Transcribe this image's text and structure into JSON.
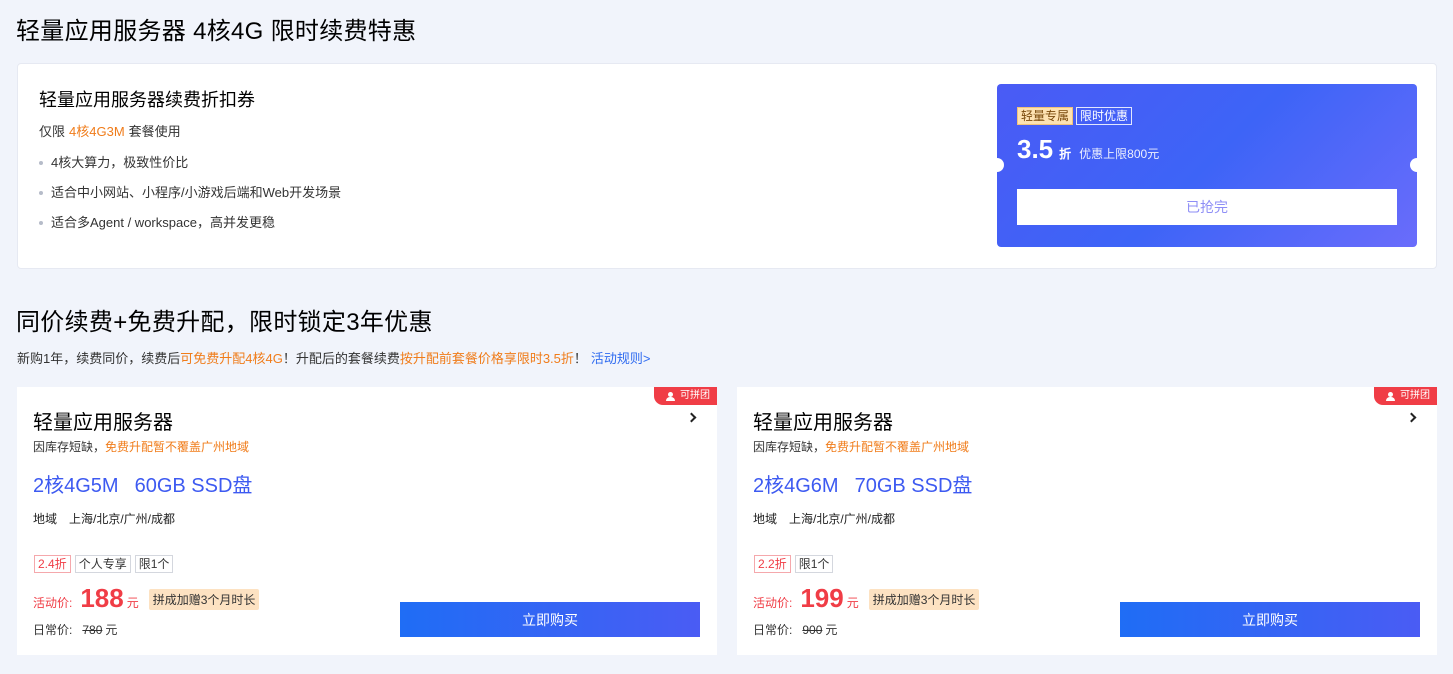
{
  "page_title": "轻量应用服务器 4核4G 限时续费特惠",
  "coupon": {
    "title": "轻量应用服务器续费折扣券",
    "sub_prefix": "仅限",
    "sub_highlight": "4核4G3M",
    "sub_suffix": "套餐使用",
    "features": [
      "4核大算力，极致性价比",
      "适合中小网站、小程序/小游戏后端和Web开发场景",
      "适合多Agent / workspace，高并发更稳"
    ],
    "ticket": {
      "tag_exclusive": "轻量专属",
      "tag_limited": "限时优惠",
      "discount": "3.5",
      "discount_unit": "折",
      "cap": "优惠上限800元",
      "button": "已抢完"
    }
  },
  "section2": {
    "title": "同价续费+免费升配，限时锁定3年优惠",
    "desc_1": "新购1年，续费同价，续费后",
    "desc_2": "可免费升配4核4G",
    "desc_3": "！升配后的套餐续费",
    "desc_4": "按升配前套餐价格享限时3.5折",
    "desc_5": "！",
    "rules_link": "活动规则>"
  },
  "products": [
    {
      "ribbon": "可拼团",
      "name": "轻量应用服务器",
      "stock_prefix": "因库存短缺，",
      "stock_note": "免费升配暂不覆盖广州地域",
      "spec_cpu": "2核4G5M",
      "spec_disk": "60GB SSD盘",
      "region_label": "地域",
      "regions": "上海/北京/广州/成都",
      "tags": [
        "2.4折",
        "个人专享",
        "限1个"
      ],
      "price_label": "活动价:",
      "price": "188",
      "price_unit": "元",
      "bonus": "拼成加赠3个月时长",
      "orig_label": "日常价:",
      "orig_price": "780",
      "orig_unit": "元",
      "buy": "立即购买"
    },
    {
      "ribbon": "可拼团",
      "name": "轻量应用服务器",
      "stock_prefix": "因库存短缺，",
      "stock_note": "免费升配暂不覆盖广州地域",
      "spec_cpu": "2核4G6M",
      "spec_disk": "70GB SSD盘",
      "region_label": "地域",
      "regions": "上海/北京/广州/成都",
      "tags": [
        "2.2折",
        "限1个"
      ],
      "price_label": "活动价:",
      "price": "199",
      "price_unit": "元",
      "bonus": "拼成加赠3个月时长",
      "orig_label": "日常价:",
      "orig_price": "900",
      "orig_unit": "元",
      "buy": "立即购买"
    }
  ]
}
